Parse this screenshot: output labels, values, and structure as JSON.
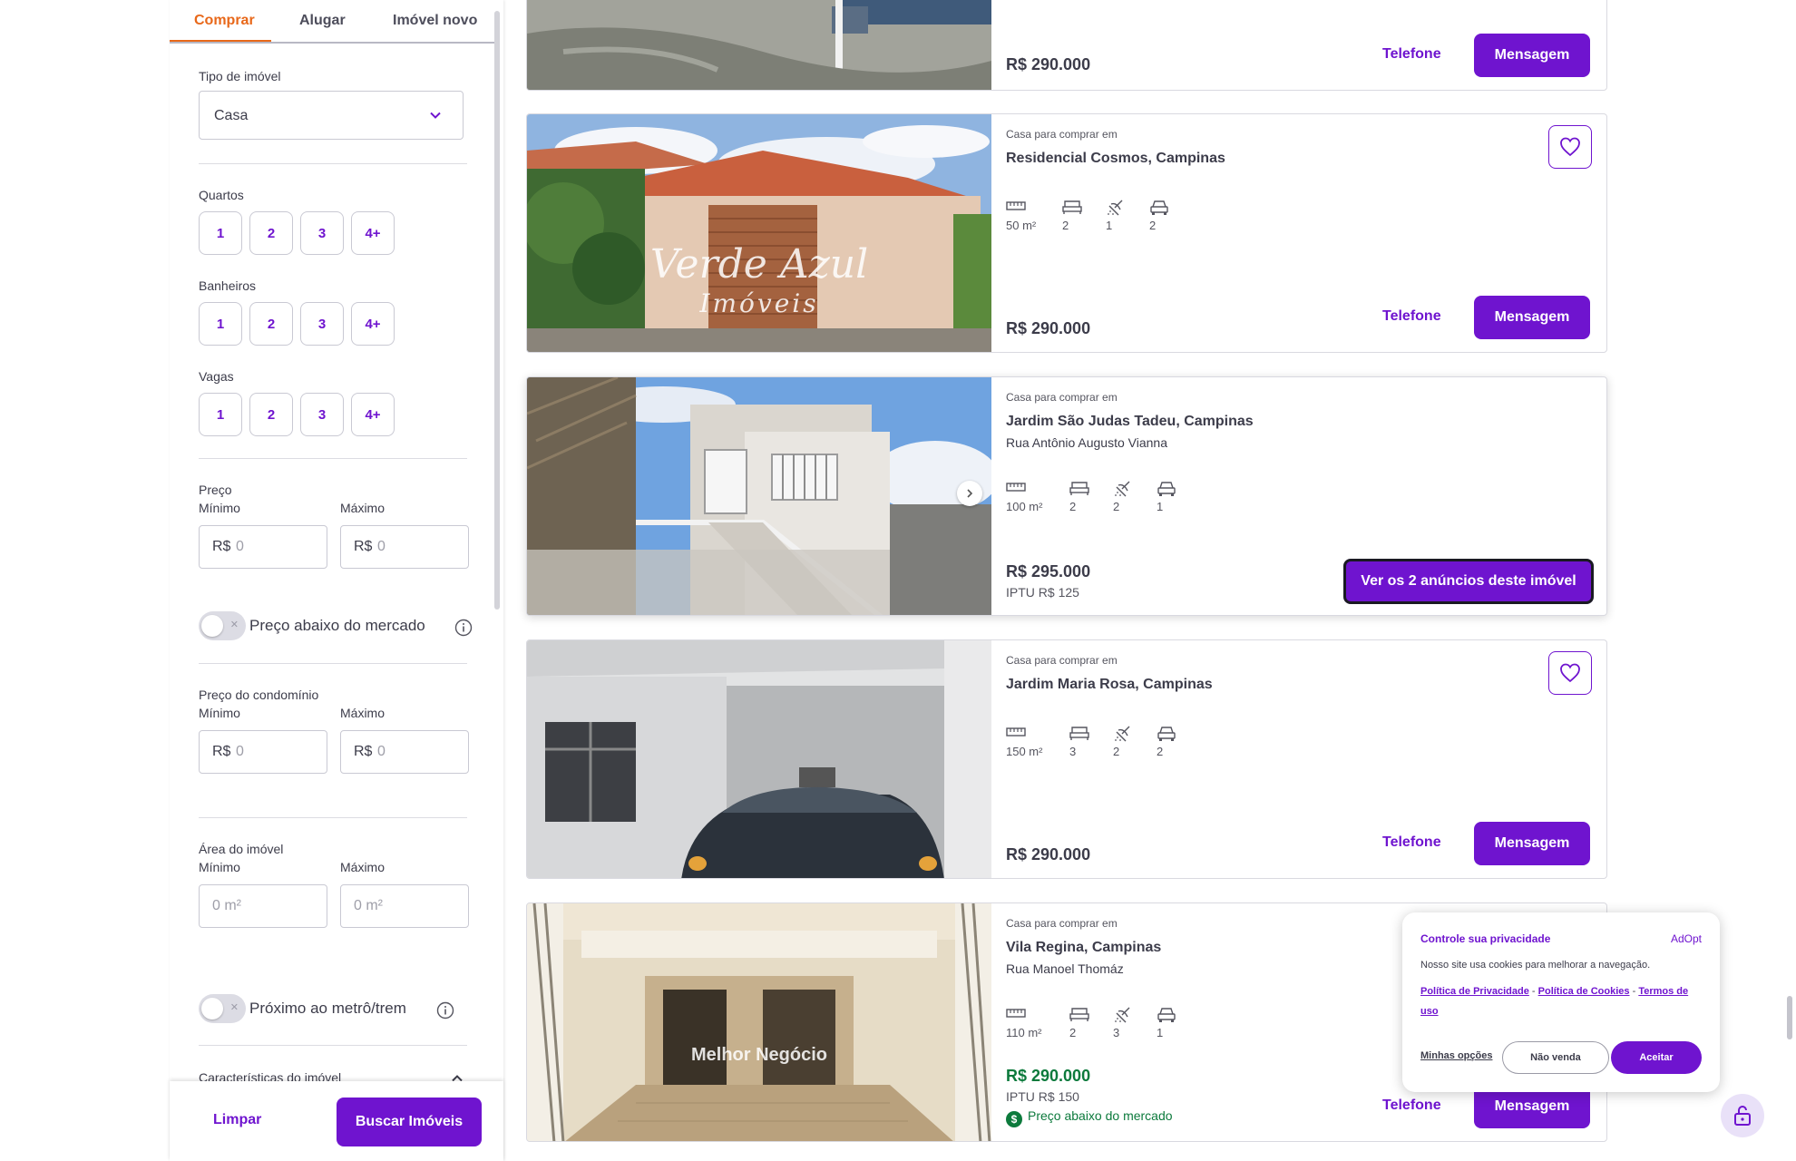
{
  "sidebar": {
    "tabs": [
      {
        "label": "Comprar"
      },
      {
        "label": "Alugar"
      },
      {
        "label": "Imóvel novo"
      }
    ],
    "tipo_label": "Tipo de imóvel",
    "tipo_value": "Casa",
    "quartos_label": "Quartos",
    "banheiros_label": "Banheiros",
    "vagas_label": "Vagas",
    "counts": [
      "1",
      "2",
      "3",
      "4+"
    ],
    "preco_label": "Preço",
    "min_label": "Mínimo",
    "max_label": "Máximo",
    "currency": "R$",
    "zero": "0",
    "area_placeholder": "0 m²",
    "below_market_label": "Preço abaixo do mercado",
    "condo_label": "Preço do condomínio",
    "area_label": "Área do imóvel",
    "metro_label": "Próximo ao metrô/trem",
    "caracteristicas_label": "Características do imóvel",
    "toggle_off": "✕",
    "clear_label": "Limpar",
    "search_label": "Buscar Imóveis"
  },
  "listings": [
    {
      "kicker": "",
      "place": "",
      "street": "",
      "features": [],
      "price": "R$ 290.000",
      "phone_label": "Telefone",
      "message_label": "Mensagem"
    },
    {
      "kicker": "Casa para comprar em",
      "place": "Residencial Cosmos, Campinas",
      "street": "",
      "features": [
        {
          "icon": "area-icon",
          "value": "50 m²"
        },
        {
          "icon": "bed-icon",
          "value": "2"
        },
        {
          "icon": "shower-icon",
          "value": "1"
        },
        {
          "icon": "car-icon",
          "value": "2"
        }
      ],
      "price": "R$ 290.000",
      "phone_label": "Telefone",
      "message_label": "Mensagem",
      "watermark_line1": "Verde Azul",
      "watermark_line2": "Imóveis"
    },
    {
      "kicker": "Casa para comprar em",
      "place": "Jardim São Judas Tadeu, Campinas",
      "street": "Rua Antônio Augusto Vianna",
      "features": [
        {
          "icon": "area-icon",
          "value": "100 m²"
        },
        {
          "icon": "bed-icon",
          "value": "2"
        },
        {
          "icon": "shower-icon",
          "value": "2"
        },
        {
          "icon": "car-icon",
          "value": "1"
        }
      ],
      "price": "R$ 295.000",
      "iptu": "IPTU R$ 125",
      "multi_label": "Ver os 2 anúncios deste imóvel"
    },
    {
      "kicker": "Casa para comprar em",
      "place": "Jardim Maria Rosa, Campinas",
      "street": "",
      "features": [
        {
          "icon": "area-icon",
          "value": "150 m²"
        },
        {
          "icon": "bed-icon",
          "value": "3"
        },
        {
          "icon": "shower-icon",
          "value": "2"
        },
        {
          "icon": "car-icon",
          "value": "2"
        }
      ],
      "price": "R$ 290.000",
      "phone_label": "Telefone",
      "message_label": "Mensagem"
    },
    {
      "kicker": "Casa para comprar em",
      "place": "Vila Regina, Campinas",
      "street": "Rua Manoel Thomáz",
      "features": [
        {
          "icon": "area-icon",
          "value": "110 m²"
        },
        {
          "icon": "bed-icon",
          "value": "2"
        },
        {
          "icon": "shower-icon",
          "value": "3"
        },
        {
          "icon": "car-icon",
          "value": "1"
        }
      ],
      "price": "R$ 290.000",
      "iptu": "IPTU R$ 150",
      "below_market": "Preço abaixo do mercado",
      "below_icon": "$",
      "phone_label": "Telefone",
      "message_label": "Mensagem",
      "watermark_line1": "Melhor Negócio"
    }
  ],
  "cookie": {
    "title": "Controle sua privacidade",
    "brand": "AdOpt",
    "text": "Nosso site usa cookies para melhorar a navegação.",
    "privacy_link": "Política de Privacidade",
    "cookies_link": "Política de Cookies",
    "terms_link": "Termos de uso",
    "separator": "-",
    "options_label": "Minhas opções",
    "no_sell_label": "Não venda",
    "accept_label": "Aceitar"
  },
  "colors": {
    "accent": "#6f14cf",
    "active_tab": "#e8681a",
    "green": "#0c7a3c"
  }
}
